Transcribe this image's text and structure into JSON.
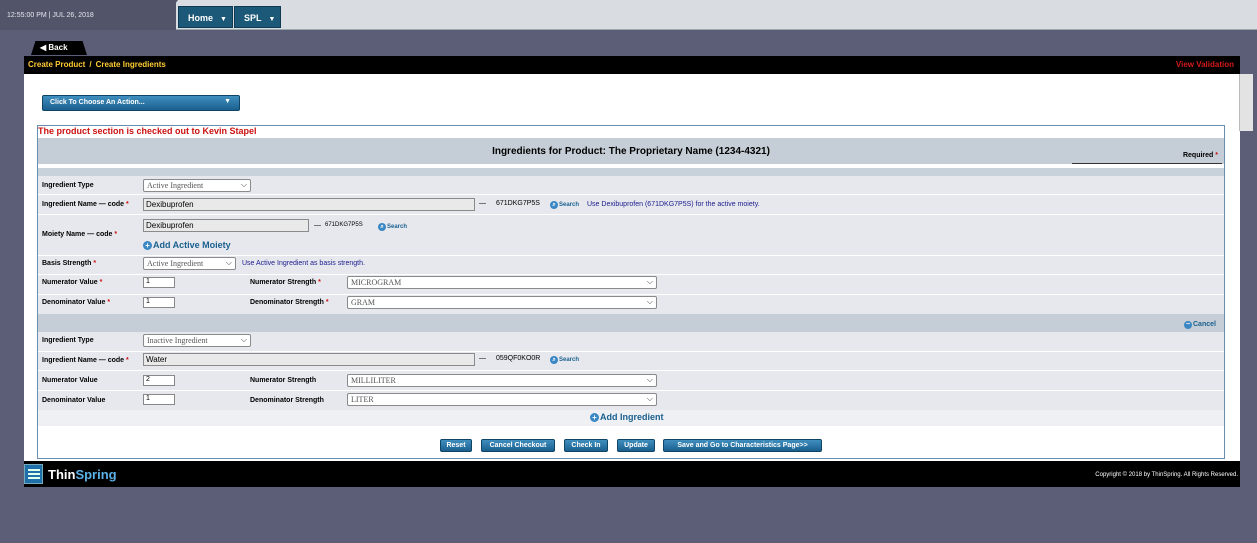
{
  "topbar": {
    "datetime": "12:55:00 PM | JUL 26, 2018",
    "nav": [
      {
        "label": "Home"
      },
      {
        "label": "SPL"
      }
    ]
  },
  "back_label": "Back",
  "breadcrumb": {
    "part1": "Create Product",
    "sep": "/",
    "part2": "Create Ingredients"
  },
  "view_validation": "View Validation",
  "action_menu": "Click To Choose An Action...",
  "checkout_msg": "The product section is checked out to Kevin Stapel",
  "form": {
    "heading": "Ingredients for Product: The Proprietary Name (1234-4321)",
    "required": "Required",
    "active": {
      "ingredient_type_label": "Ingredient Type",
      "ingredient_type_value": "Active Ingredient",
      "ingredient_name_label": "Ingredient Name — code",
      "ingredient_name_value": "Dexibuprofen",
      "dash": "—",
      "ingredient_code": "671DKG7P5S",
      "search_label": "Search",
      "ingredient_note": "Use Dexibuprofen (671DKG7P5S) for the active moiety.",
      "moiety_label": "Moiety Name — code",
      "moiety_value": "Dexibuprofen",
      "moiety_code": "671DKG7P5S",
      "add_moiety": "Add Active Moiety",
      "basis_label": "Basis Strength",
      "basis_value": "Active Ingredient",
      "basis_note": "Use Active Ingredient as basis strength.",
      "num_value_label": "Numerator Value",
      "num_value": "1",
      "num_strength_label": "Numerator Strength",
      "num_strength_value": "MICROGRAM",
      "den_value_label": "Denominator Value",
      "den_value": "1",
      "den_strength_label": "Denominator Strength",
      "den_strength_value": "GRAM"
    },
    "cancel_label": "Cancel",
    "inactive": {
      "ingredient_type_label": "Ingredient Type",
      "ingredient_type_value": "Inactive Ingredient",
      "ingredient_name_label": "Ingredient Name — code",
      "ingredient_name_value": "Water",
      "ingredient_code": "059QF0KO0R",
      "num_value_label": "Numerator Value",
      "num_value": "2",
      "num_strength_label": "Numerator Strength",
      "num_strength_value": "MILLILITER",
      "den_value_label": "Denominator Value",
      "den_value": "1",
      "den_strength_label": "Denominator Strength",
      "den_strength_value": "LITER"
    },
    "add_ingredient": "Add Ingredient",
    "buttons": {
      "reset": "Reset",
      "cancel_checkout": "Cancel Checkout",
      "check_in": "Check In",
      "update": "Update",
      "save_go": "Save and Go to Characteristics Page>>"
    }
  },
  "footer": {
    "logo_part1": "Thin",
    "logo_part2": "Spring",
    "copyright": "Copyright © 2018 by ThinSpring. All Rights Reserved."
  },
  "colors": {
    "accent": "#1a5f8e",
    "alert": "#cc1111",
    "breadcrumb": "#ffcc33"
  }
}
